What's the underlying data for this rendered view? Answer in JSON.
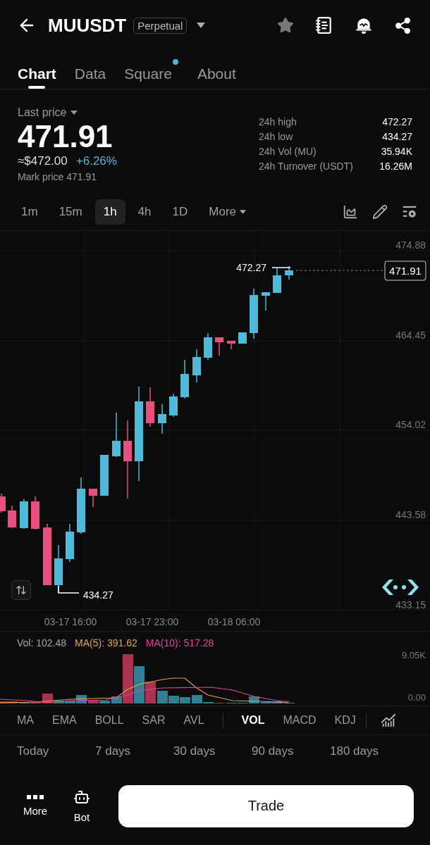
{
  "header": {
    "symbol": "MUUSDT",
    "badge": "Perpetual"
  },
  "tabs": [
    {
      "label": "Chart",
      "selected": true,
      "dot": false
    },
    {
      "label": "Data",
      "selected": false,
      "dot": false
    },
    {
      "label": "Square",
      "selected": false,
      "dot": true
    },
    {
      "label": "About",
      "selected": false,
      "dot": false
    }
  ],
  "price": {
    "label": "Last price",
    "value": "471.91",
    "approx": "≈$472.00",
    "change": "+6.26%",
    "mark": "Mark price 471.91"
  },
  "stats": [
    {
      "label": "24h high",
      "value": "472.27"
    },
    {
      "label": "24h low",
      "value": "434.27"
    },
    {
      "label": "24h Vol (MU)",
      "value": "35.94K"
    },
    {
      "label": "24h Turnover (USDT)",
      "value": "16.26M"
    }
  ],
  "intervals": [
    {
      "label": "1m",
      "selected": false,
      "kind": "plain"
    },
    {
      "label": "15m",
      "selected": false,
      "kind": "plain"
    },
    {
      "label": "1h",
      "selected": true,
      "kind": "plain"
    },
    {
      "label": "4h",
      "selected": false,
      "kind": "plain"
    },
    {
      "label": "1D",
      "selected": false,
      "kind": "plain"
    },
    {
      "label": "More",
      "selected": false,
      "kind": "dropdown"
    }
  ],
  "chart": {
    "price_ticks": [
      "474.88",
      "464.45",
      "454.02",
      "443.58",
      "433.15"
    ],
    "high_label": "472.27",
    "low_label": "434.27",
    "current_price": "471.91",
    "time_labels": [
      "03-17 16:00",
      "03-17 23:00",
      "03-18 06:00"
    ]
  },
  "volume": {
    "legend": [
      {
        "text": "Vol: 102.48",
        "color": "#a8a8a8"
      },
      {
        "text": "MA(5): 391.62",
        "color": "#e0a83b"
      },
      {
        "text": "MA(10): 517.28",
        "color": "#e0449a"
      }
    ],
    "ticks": [
      "9.05K",
      "0.00"
    ]
  },
  "indicators": [
    {
      "label": "MA",
      "selected": false
    },
    {
      "label": "EMA",
      "selected": false
    },
    {
      "label": "BOLL",
      "selected": false
    },
    {
      "label": "SAR",
      "selected": false
    },
    {
      "label": "AVL",
      "selected": false
    },
    {
      "label": "VOL",
      "selected": true
    },
    {
      "label": "MACD",
      "selected": false
    },
    {
      "label": "KDJ",
      "selected": false
    }
  ],
  "periods": [
    "Today",
    "7 days",
    "30 days",
    "90 days",
    "180 days"
  ],
  "bottom_bar": {
    "more": "More",
    "bot": "Bot",
    "trade": "Trade"
  }
}
